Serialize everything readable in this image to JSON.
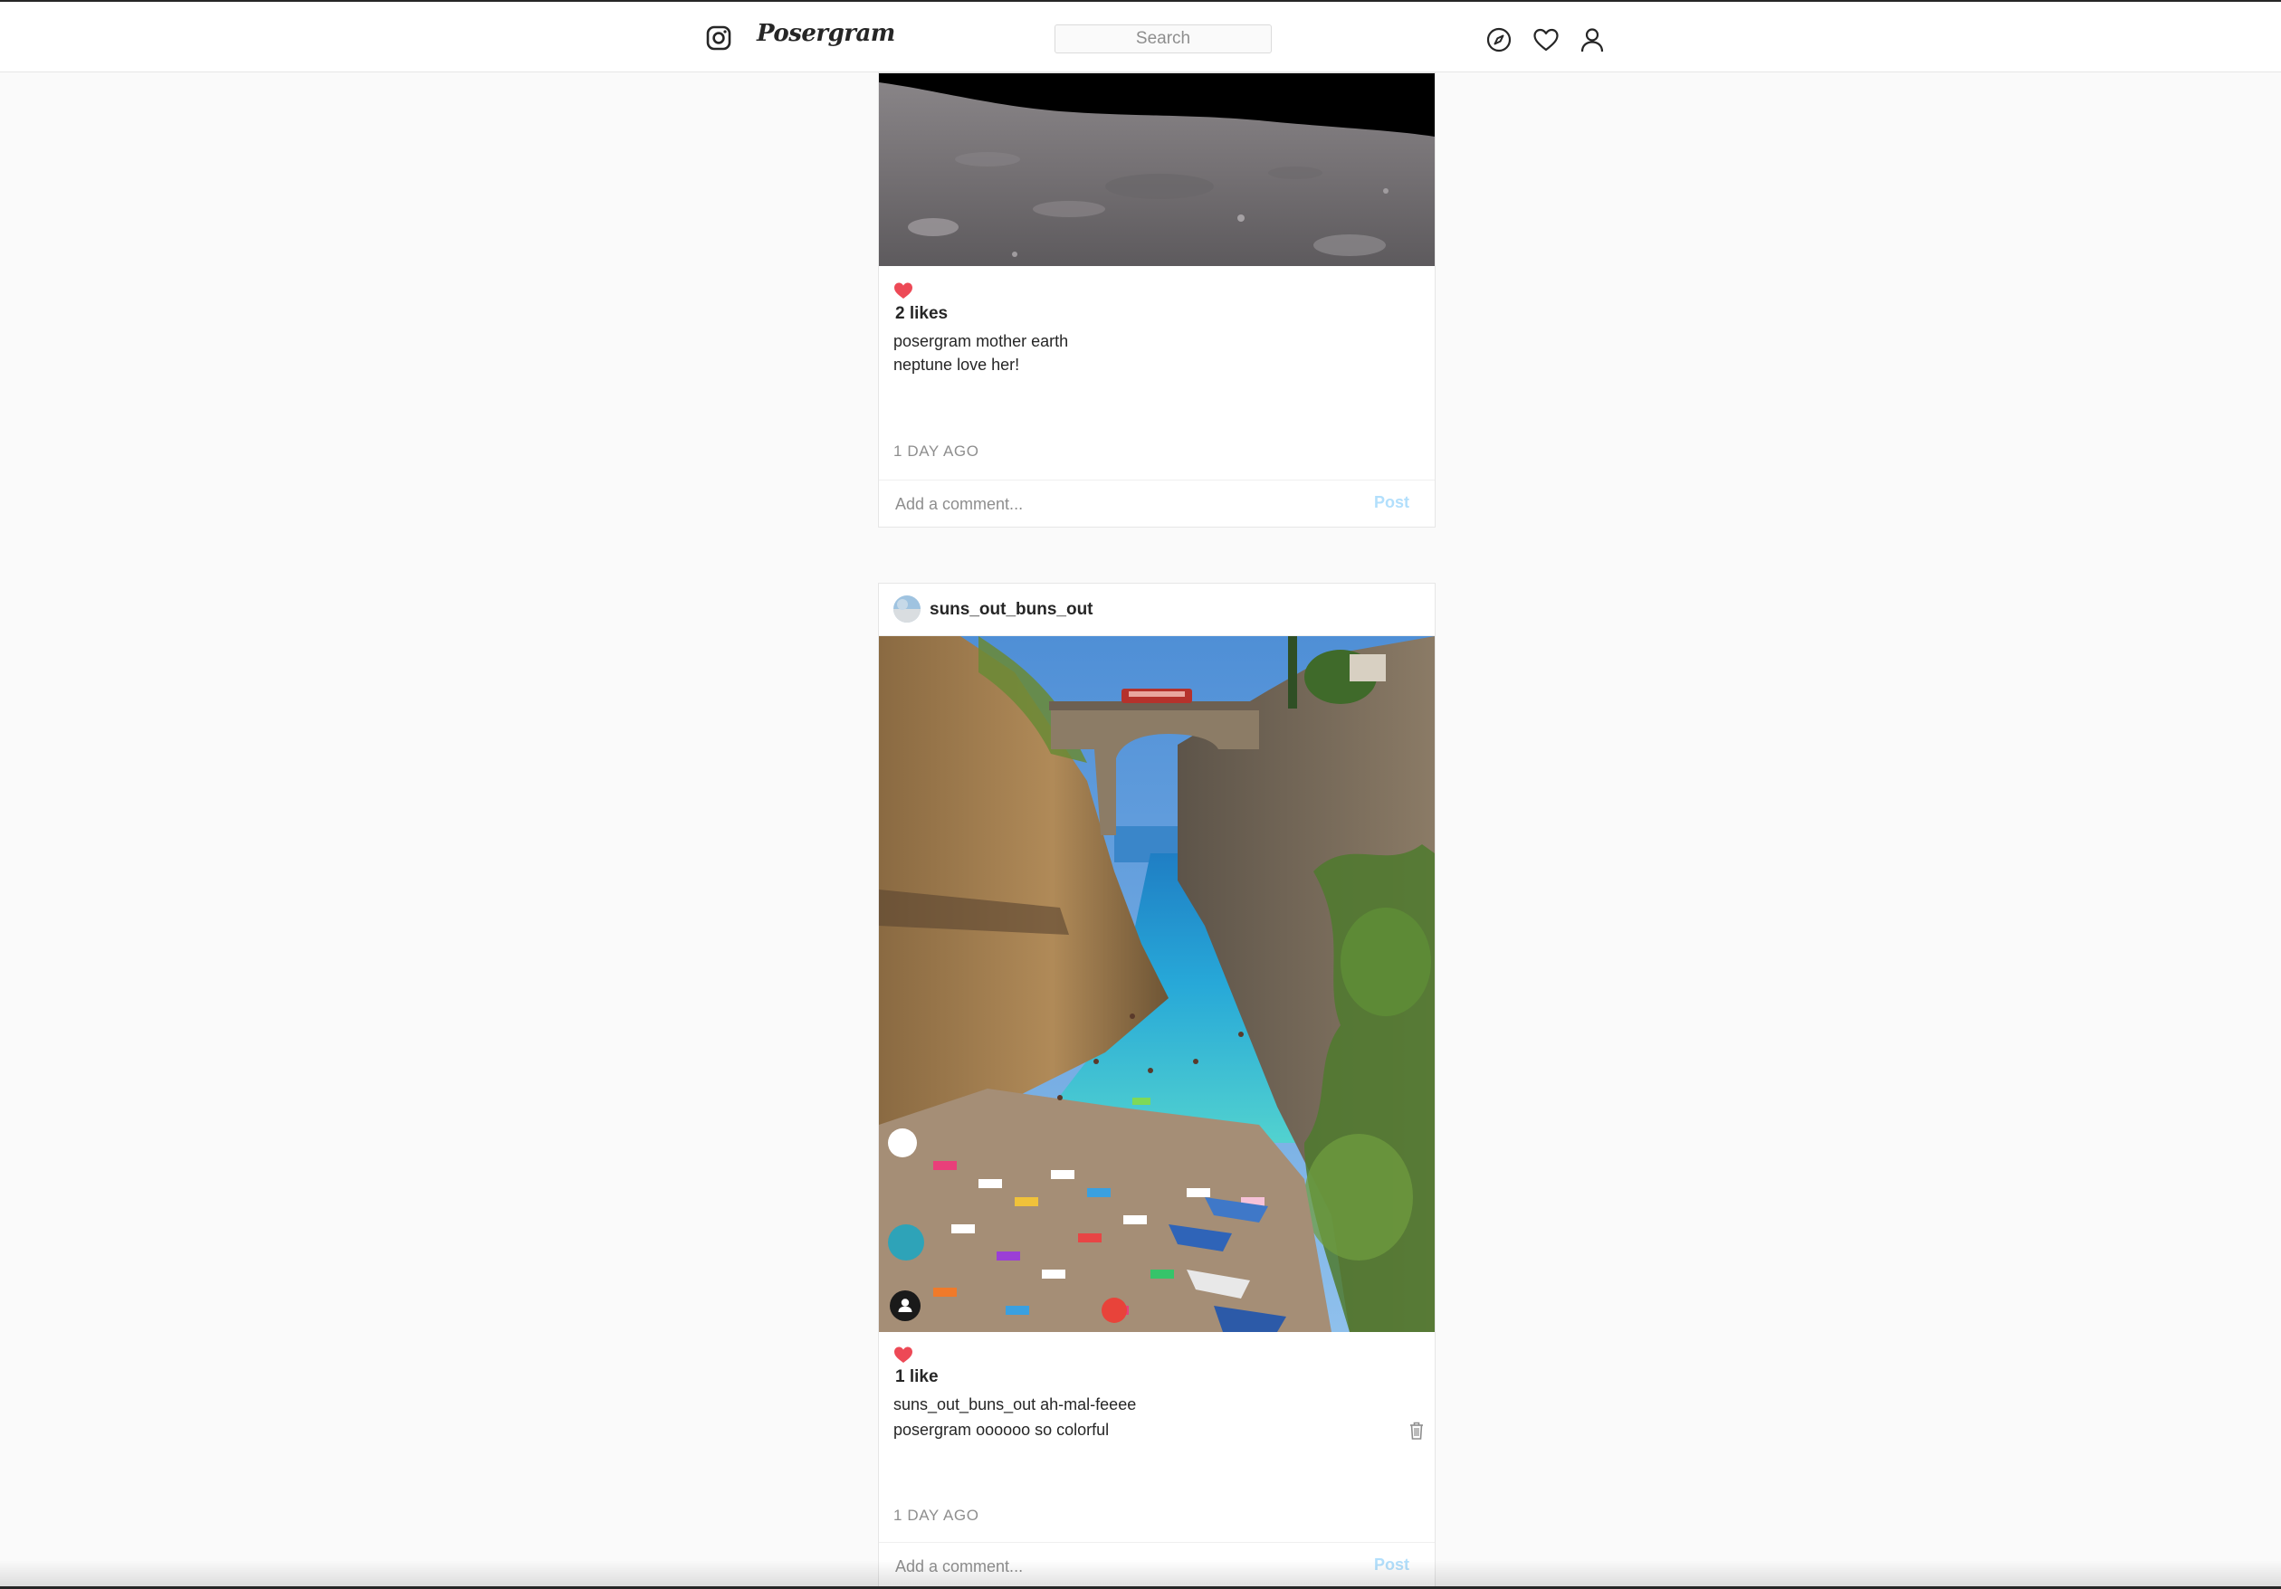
{
  "header": {
    "brand": "Posergram",
    "search_placeholder": "Search",
    "icons": [
      "instagram-icon",
      "explore-icon",
      "heart-icon",
      "profile-icon"
    ]
  },
  "colors": {
    "like_red": "#ed4956",
    "post_button": "#b2dffc",
    "muted_text": "#8e8e8e",
    "page_background": "#fafafa"
  },
  "posts": [
    {
      "image": "moon-surface",
      "likes": "2 likes",
      "liked": true,
      "comments": [
        {
          "user": "posergram",
          "text": "mother earth"
        },
        {
          "user": "neptune",
          "text": "love her!"
        }
      ],
      "timestamp": "1 DAY AGO",
      "comment_placeholder": "Add a comment...",
      "post_label": "Post"
    },
    {
      "username": "suns_out_buns_out",
      "image": "cliff-beach-bridge",
      "likes": "1 like",
      "liked": true,
      "comments": [
        {
          "user": "suns_out_buns_out",
          "text": "ah-mal-feeee"
        },
        {
          "user": "posergram",
          "text": "oooooo so colorful"
        }
      ],
      "timestamp": "1 DAY AGO",
      "comment_placeholder": "Add a comment...",
      "post_label": "Post"
    }
  ]
}
